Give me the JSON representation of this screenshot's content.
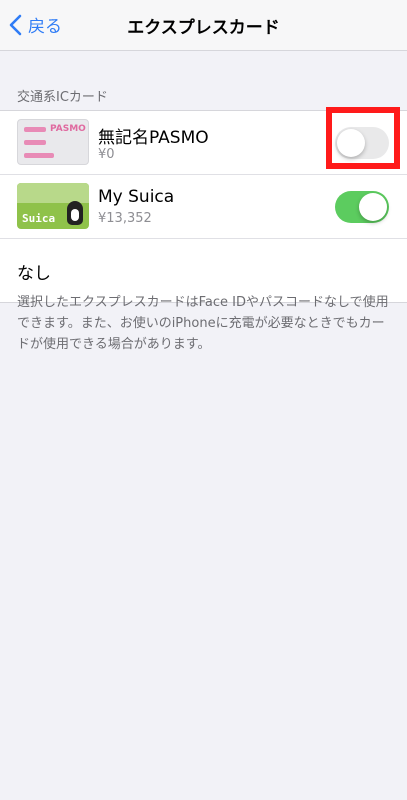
{
  "nav": {
    "back_label": "戻る",
    "title": "エクスプレスカード"
  },
  "section": {
    "label": "交通系ICカード"
  },
  "cards": [
    {
      "name": "無記名PASMO",
      "balance": "¥0",
      "toggle": "off",
      "card_art": "PASMO"
    },
    {
      "name": "My Suica",
      "balance": "¥13,352",
      "toggle": "on",
      "card_art": "Suica"
    }
  ],
  "none_label": "なし",
  "footer_text": "選択したエクスプレスカードはFace IDやパスコードなしで使用できます。また、お使いのiPhoneに充電が必要なときでもカードが使用できる場合があります。",
  "colors": {
    "accent": "#2f7cf6",
    "toggle_on": "#5ccc5f",
    "highlight": "#ff1a1a"
  }
}
